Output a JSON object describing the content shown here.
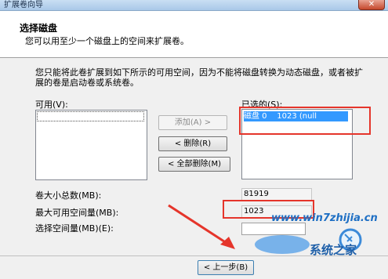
{
  "window": {
    "title": "扩展卷向导",
    "close_glyph": "✕"
  },
  "header": {
    "title": "选择磁盘",
    "subtitle": "您可以用至少一个磁盘上的空间来扩展卷。"
  },
  "description": "您只能将此卷扩展到如下所示的可用空间，因为不能将磁盘转换为动态磁盘，或者被扩展的卷是启动卷或系统卷。",
  "available": {
    "label": "可用(V):",
    "items": []
  },
  "selected": {
    "label": "已选的(S):",
    "items": [
      {
        "name": "磁盘 0",
        "size": "1023 (null"
      }
    ]
  },
  "buttons": {
    "add": "添加(A) >",
    "remove": "< 删除(R)",
    "remove_all": "< 全部删除(M)",
    "back": "< 上一步(B)"
  },
  "fields": {
    "total_label": "卷大小总数(MB):",
    "total_value": "81919",
    "max_label": "最大可用空间量(MB):",
    "max_value": "1023",
    "select_label": "选择空间量(MB)(E):",
    "select_value": ""
  },
  "watermark": {
    "site": "www.win7zhijia.cn",
    "brand": "系统之家"
  },
  "colors": {
    "highlight": "#e5352b",
    "selection": "#3399ff"
  }
}
